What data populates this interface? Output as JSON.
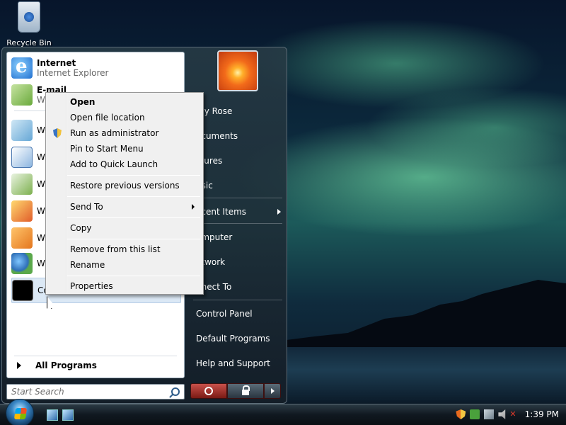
{
  "desktop": {
    "recycle_bin_label": "Recycle Bin"
  },
  "start_menu": {
    "programs": [
      {
        "name": "Internet",
        "sub": "Internet Explorer",
        "icon": "internet-explorer-icon"
      },
      {
        "name": "E-mail",
        "sub": "Wi",
        "icon": "mail-icon"
      },
      {
        "name": "We",
        "icon": "welcome-center-icon"
      },
      {
        "name": "Wi",
        "icon": "task-icon"
      },
      {
        "name": "Wi",
        "icon": "fax-scan-icon"
      },
      {
        "name": "Wi",
        "icon": "photo-gallery-icon"
      },
      {
        "name": "Wi",
        "icon": "media-player-icon"
      },
      {
        "name": "Wi",
        "icon": "contacts-icon"
      },
      {
        "name": "Co",
        "icon": "command-prompt-icon"
      }
    ],
    "all_programs": "All Programs",
    "search_placeholder": "Start Search",
    "right_items": [
      {
        "label": "my Rose",
        "has_submenu": false
      },
      {
        "label": "ocuments",
        "has_submenu": false
      },
      {
        "label": "ctures",
        "has_submenu": false
      },
      {
        "label": "usic",
        "has_submenu": false
      },
      {
        "label": "ecent Items",
        "has_submenu": true
      },
      {
        "label": "omputer",
        "has_submenu": false
      },
      {
        "label": "etwork",
        "has_submenu": false
      },
      {
        "label": "nnect To",
        "has_submenu": false
      },
      {
        "label": "Control Panel",
        "has_submenu": false
      },
      {
        "label": "Default Programs",
        "has_submenu": false
      },
      {
        "label": "Help and Support",
        "has_submenu": false
      }
    ]
  },
  "context_menu": {
    "items": [
      {
        "label": "Open",
        "bold": true
      },
      {
        "label": "Open file location"
      },
      {
        "label": "Run as administrator",
        "icon": "uac-shield-icon"
      },
      {
        "label": "Pin to Start Menu"
      },
      {
        "label": "Add to Quick Launch"
      },
      {
        "label": "Restore previous versions"
      },
      {
        "label": "Send To",
        "has_submenu": true
      },
      {
        "label": "Copy"
      },
      {
        "label": "Remove from this list"
      },
      {
        "label": "Rename"
      },
      {
        "label": "Properties"
      }
    ]
  },
  "taskbar": {
    "clock": "1:39 PM"
  }
}
